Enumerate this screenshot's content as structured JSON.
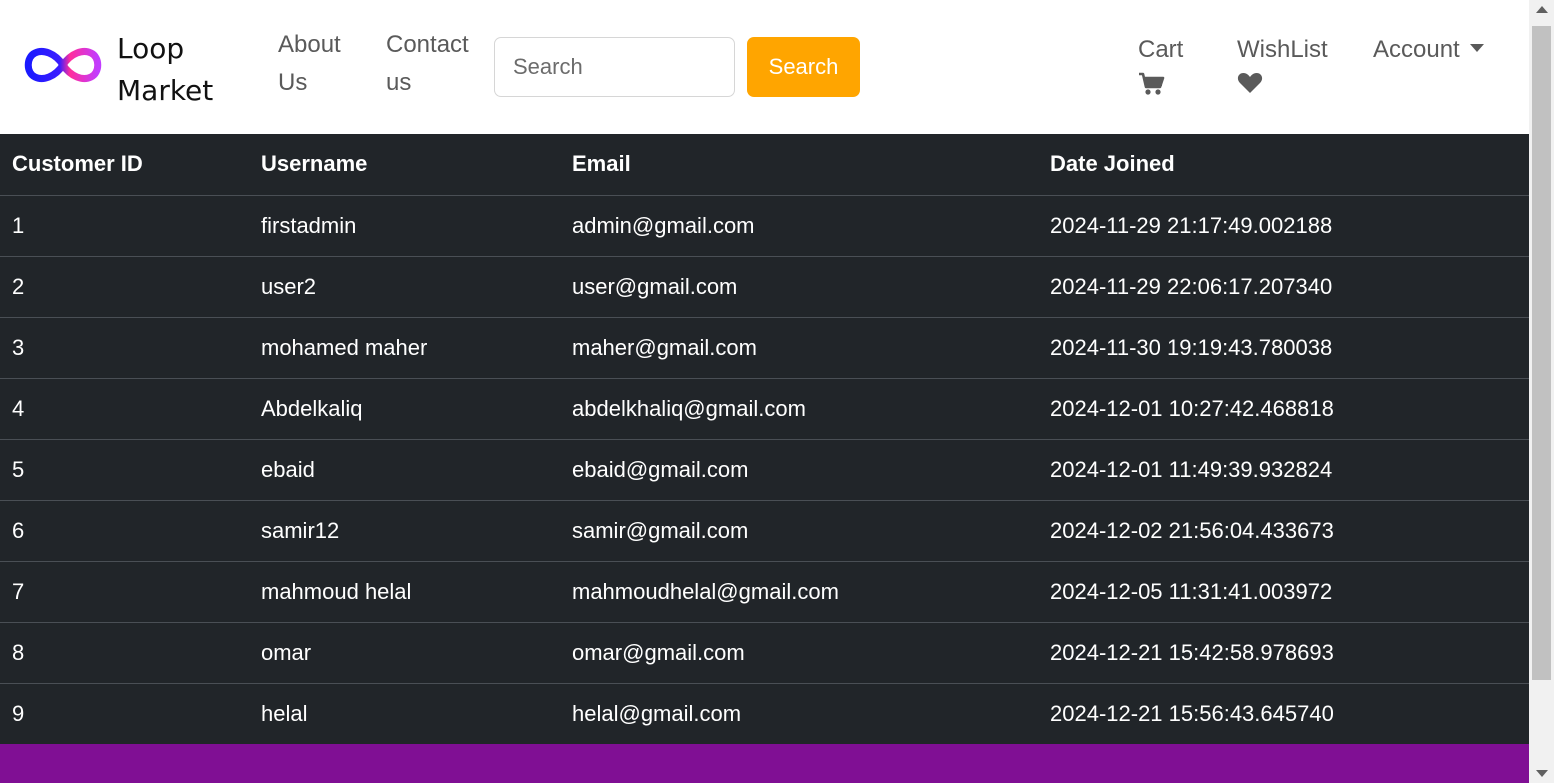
{
  "navbar": {
    "brand_line1": "Loop",
    "brand_line2": "Market",
    "links": {
      "about": "About Us",
      "contact": "Contact us"
    },
    "search": {
      "placeholder": "Search",
      "button_label": "Search"
    },
    "right": {
      "cart_label": "Cart",
      "cart_icon": "cart-icon",
      "wishlist_label": "WishList",
      "wishlist_icon": "heart-icon",
      "account_label": "Account"
    },
    "colors": {
      "search_button": "#ffa500",
      "nav_text": "#5a5a5a"
    }
  },
  "table": {
    "headers": {
      "id": "Customer ID",
      "username": "Username",
      "email": "Email",
      "date": "Date Joined"
    },
    "rows": [
      {
        "id": "1",
        "username": "firstadmin",
        "email": "admin@gmail.com",
        "date": "2024-11-29 21:17:49.002188"
      },
      {
        "id": "2",
        "username": "user2",
        "email": "user@gmail.com",
        "date": "2024-11-29 22:06:17.207340"
      },
      {
        "id": "3",
        "username": "mohamed maher",
        "email": "maher@gmail.com",
        "date": "2024-11-30 19:19:43.780038"
      },
      {
        "id": "4",
        "username": "Abdelkaliq",
        "email": "abdelkhaliq@gmail.com",
        "date": "2024-12-01 10:27:42.468818"
      },
      {
        "id": "5",
        "username": "ebaid",
        "email": "ebaid@gmail.com",
        "date": "2024-12-01 11:49:39.932824"
      },
      {
        "id": "6",
        "username": "samir12",
        "email": "samir@gmail.com",
        "date": "2024-12-02 21:56:04.433673"
      },
      {
        "id": "7",
        "username": "mahmoud helal",
        "email": "mahmoudhelal@gmail.com",
        "date": "2024-12-05 11:31:41.003972"
      },
      {
        "id": "8",
        "username": "omar",
        "email": "omar@gmail.com",
        "date": "2024-12-21 15:42:58.978693"
      },
      {
        "id": "9",
        "username": "helal",
        "email": "helal@gmail.com",
        "date": "2024-12-21 15:56:43.645740"
      }
    ],
    "colors": {
      "background": "#212529",
      "text": "#ffffff"
    }
  },
  "footer": {
    "color": "#800f94"
  }
}
